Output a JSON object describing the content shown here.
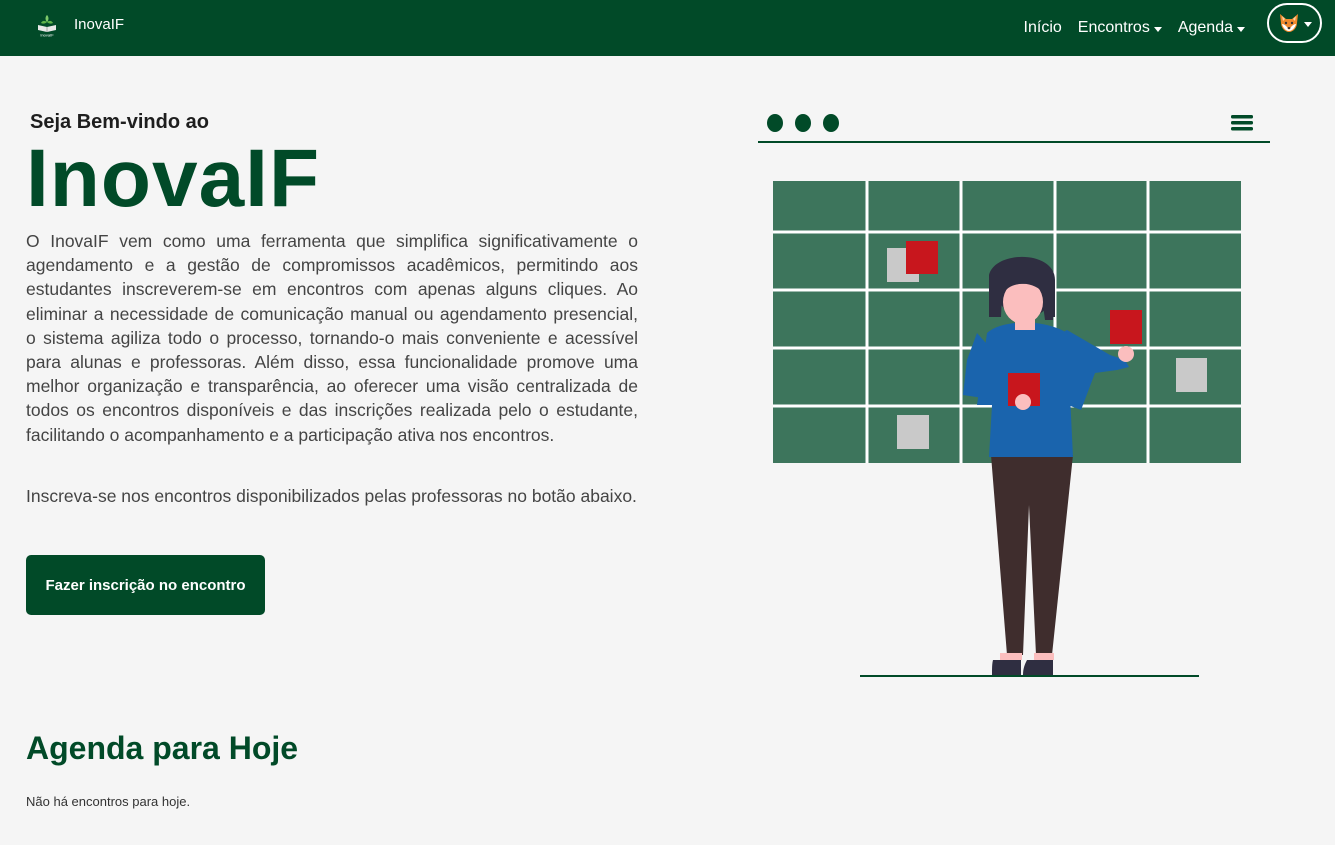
{
  "brand": {
    "name": "InovaIF",
    "logo_icon": "book-plant-logo"
  },
  "nav": {
    "items": [
      {
        "label": "Início",
        "has_dropdown": false
      },
      {
        "label": "Encontros",
        "has_dropdown": true
      },
      {
        "label": "Agenda",
        "has_dropdown": true
      }
    ],
    "avatar_icon": "fox-avatar-icon"
  },
  "hero": {
    "welcome": "Seja Bem-vindo ao",
    "title": "InovaIF",
    "description": "O InovaIF vem como uma ferramenta que simplifica significativamente o agendamento e a gestão de compromissos acadêmicos, permitindo aos estudantes inscreverem-se em encontros com apenas alguns cliques. Ao eliminar a necessidade de comunicação manual ou agendamento presencial, o sistema agiliza todo o processo, tornando-o mais conveniente e acessível para alunas e professoras. Além disso, essa funcionalidade promove uma melhor organização e transparência, ao oferecer uma visão centralizada de todos os encontros disponíveis e das inscrições realizada pelo o estudante, facilitando o acompanhamento e a participação ativa nos encontros.",
    "cta_text": "Inscreva-se nos encontros disponibilizados pelas professoras no botão abaixo.",
    "cta_button": "Fazer inscrição no encontro"
  },
  "agenda": {
    "title": "Agenda para Hoje",
    "empty_message": "Não há encontros para hoje."
  },
  "colors": {
    "primary": "#014a28",
    "background": "#f5f5f5",
    "calendar_cell": "#3d755c",
    "accent_red": "#c8161d",
    "sticky_gray": "#c9c9c9",
    "shirt_blue": "#1a64ad",
    "pants_brown": "#3f2d2d"
  }
}
